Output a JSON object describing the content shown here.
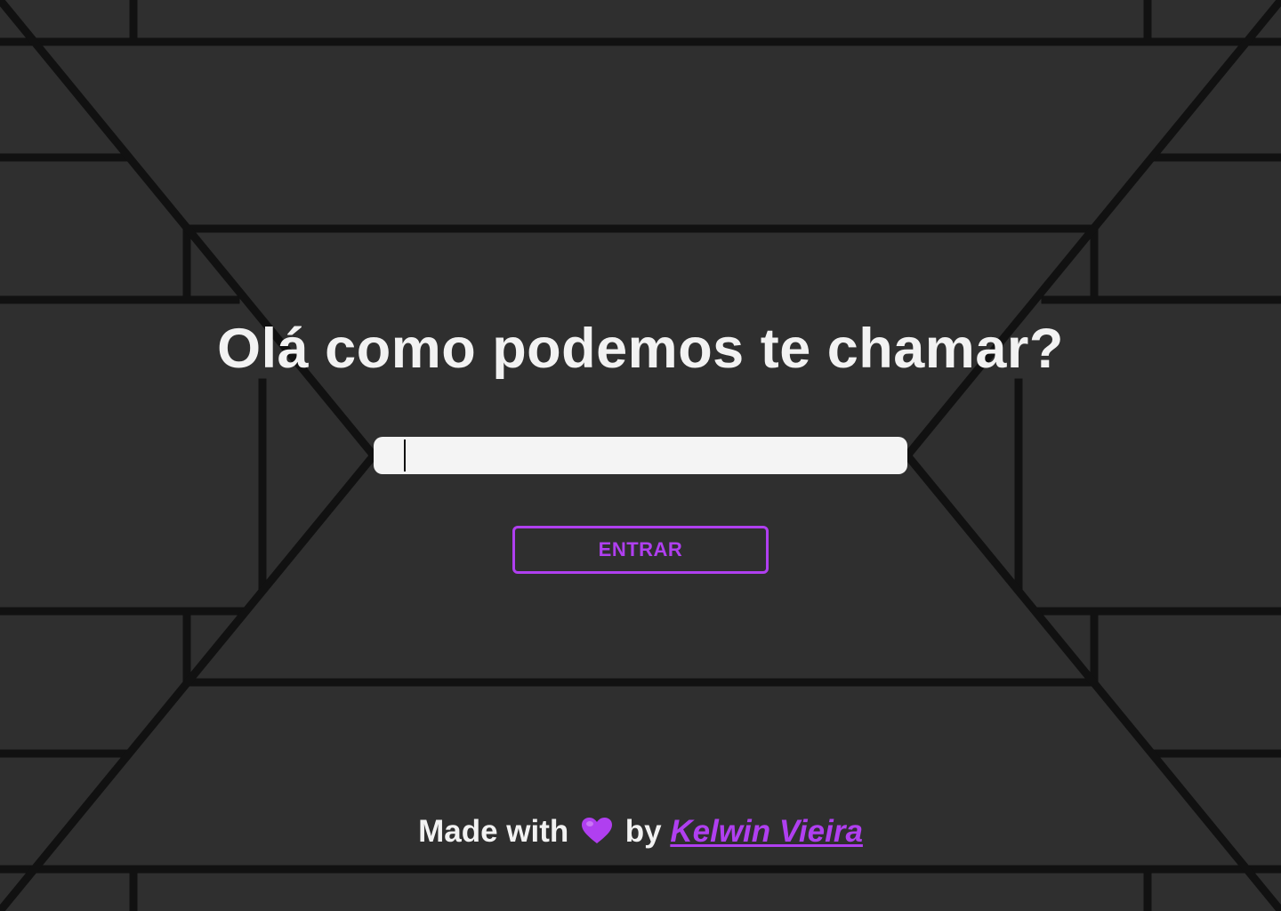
{
  "page": {
    "title": "Olá como podemos te chamar?",
    "name_input": {
      "value": "",
      "placeholder": ""
    },
    "enter_label": "ENTRAR"
  },
  "footer": {
    "made_with": "Made with",
    "heart_icon": "purple-heart-icon",
    "by": "by",
    "author": "Kelwin Vieira"
  },
  "colors": {
    "background": "#2f2f2f",
    "lines": "#111111",
    "accent": "#b03ff0",
    "text": "#f2f2f2",
    "input_bg": "#f4f4f4"
  }
}
